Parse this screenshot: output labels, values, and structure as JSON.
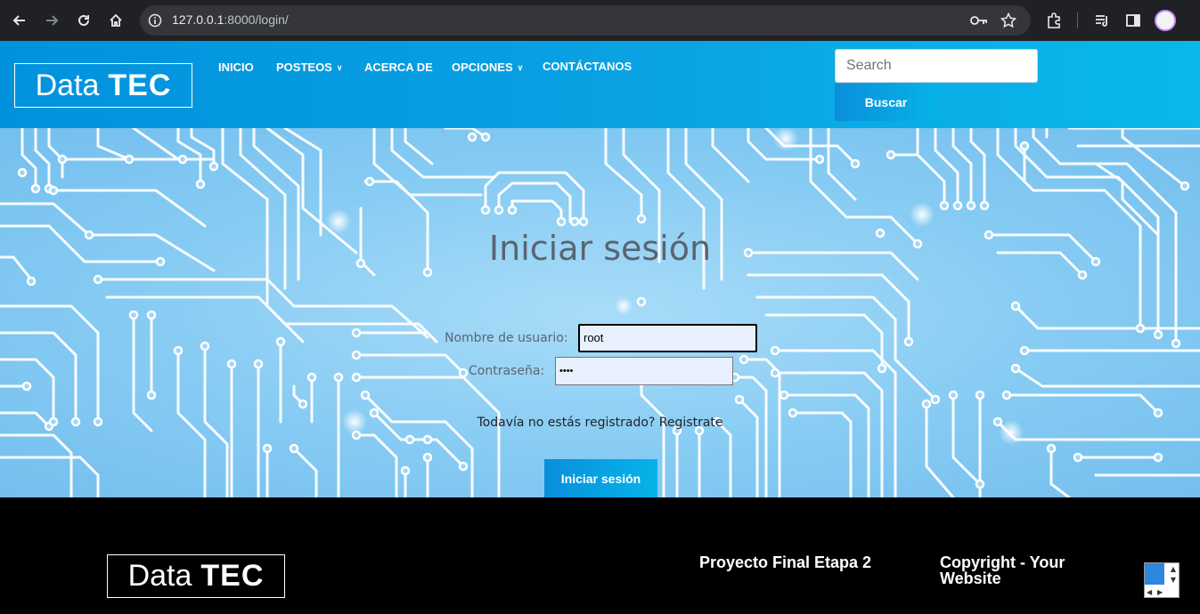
{
  "browser": {
    "url_host": "127.0.0.1",
    "url_path": ":8000/login/",
    "icons": [
      "back-icon",
      "forward-icon",
      "reload-icon",
      "home-icon",
      "info-icon",
      "key-icon",
      "star-icon",
      "extensions-icon",
      "media-icon",
      "sidebar-icon",
      "avatar"
    ]
  },
  "header": {
    "logo_light": "Data",
    "logo_bold": "TEC",
    "menu": [
      {
        "label": "INICIO",
        "dropdown": false
      },
      {
        "label": "POSTEOS",
        "dropdown": true
      },
      {
        "label": "ACERCA DE",
        "dropdown": false
      },
      {
        "label": "OPCIONES",
        "dropdown": true
      },
      {
        "label": "CONTÁCTANOS",
        "dropdown": false
      }
    ],
    "search_placeholder": "Search",
    "search_button": "Buscar"
  },
  "login": {
    "title": "Iniciar sesión",
    "username_label": "Nombre de usuario:",
    "username_value": "root",
    "password_label": "Contraseña:",
    "password_value": "••••",
    "register_text": "Todavía no estás registrado?",
    "register_link": "Registrate",
    "submit": "Iniciar sesión"
  },
  "footer": {
    "logo_light": "Data",
    "logo_bold": "TEC",
    "project": "Proyecto Final Etapa 2",
    "copyright_line1": "Copyright - Your",
    "copyright_line2": "Website"
  },
  "colors": {
    "header_start": "#0192dd",
    "header_end": "#08b9ea",
    "footer_bg": "#000000",
    "hero_bg": "#86cbf3"
  }
}
